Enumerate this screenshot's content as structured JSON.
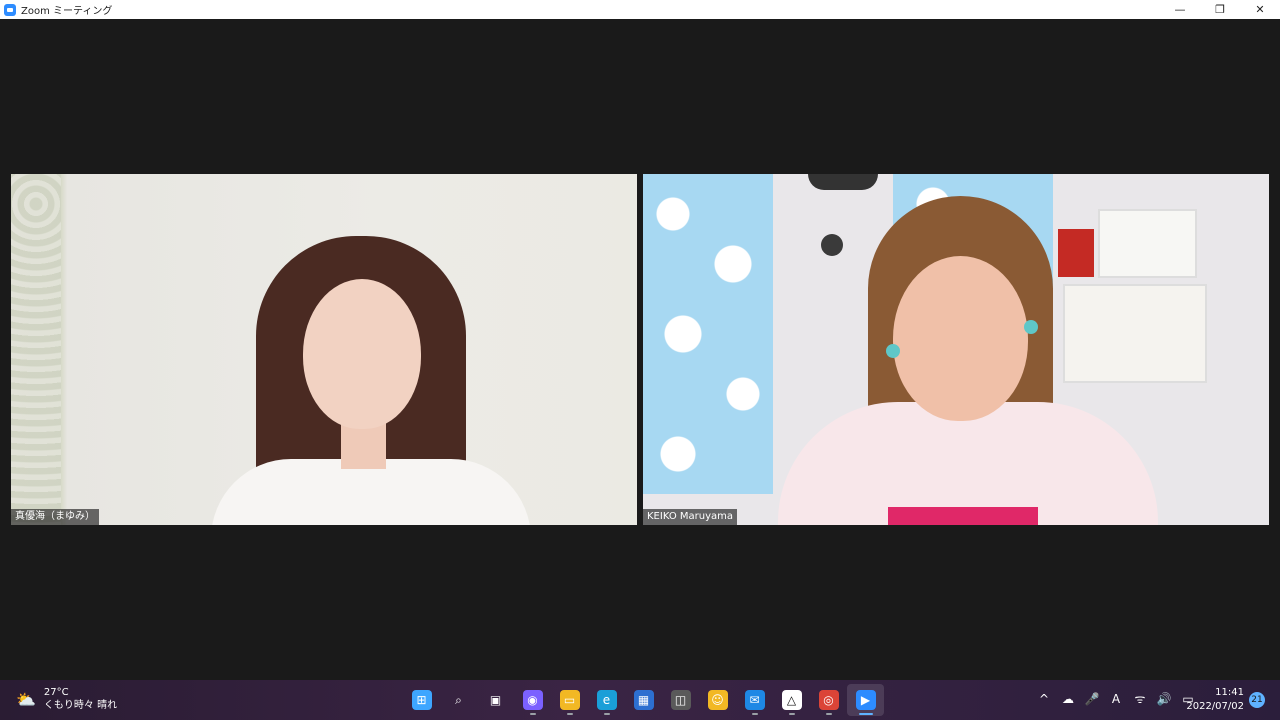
{
  "window": {
    "title": "Zoom ミーティング",
    "controls": {
      "minimize": "—",
      "restore": "❐",
      "close": "✕"
    }
  },
  "participants": [
    {
      "name": "真優海（まゆみ）"
    },
    {
      "name": "KEIKO Maruyama"
    }
  ],
  "taskbar": {
    "weather": {
      "temperature": "27°C",
      "description": "くもり時々 晴れ",
      "icon": "partly-cloudy-icon"
    },
    "apps": [
      {
        "name": "start",
        "glyph": "⊞",
        "color": "#3ea6ff"
      },
      {
        "name": "search",
        "glyph": "⌕",
        "color": "transparent"
      },
      {
        "name": "task-view",
        "glyph": "▣",
        "color": "transparent"
      },
      {
        "name": "teams-chat",
        "glyph": "◉",
        "color": "#7b61ff"
      },
      {
        "name": "file-explorer",
        "glyph": "▭",
        "color": "#f2b824"
      },
      {
        "name": "edge",
        "glyph": "e",
        "color": "#1a9fd8"
      },
      {
        "name": "store",
        "glyph": "▦",
        "color": "#2d6fd0"
      },
      {
        "name": "app-gray",
        "glyph": "◫",
        "color": "#5a5a5a"
      },
      {
        "name": "app-yellow",
        "glyph": "☺",
        "color": "#f2b824"
      },
      {
        "name": "mail",
        "glyph": "✉",
        "color": "#1e88e5"
      },
      {
        "name": "app-delta",
        "glyph": "△",
        "color": "#ffffff"
      },
      {
        "name": "chrome",
        "glyph": "◎",
        "color": "#db4437"
      },
      {
        "name": "zoom",
        "glyph": "▶",
        "color": "#2d8cff"
      }
    ],
    "tray": {
      "chevron": "^",
      "cloud": "☁",
      "mic": "🎤",
      "ime": "A",
      "wifi": "ᯤ",
      "volume": "🔊",
      "battery": "▭"
    },
    "time": "11:41",
    "date": "2022/07/02",
    "notifications": "21"
  }
}
